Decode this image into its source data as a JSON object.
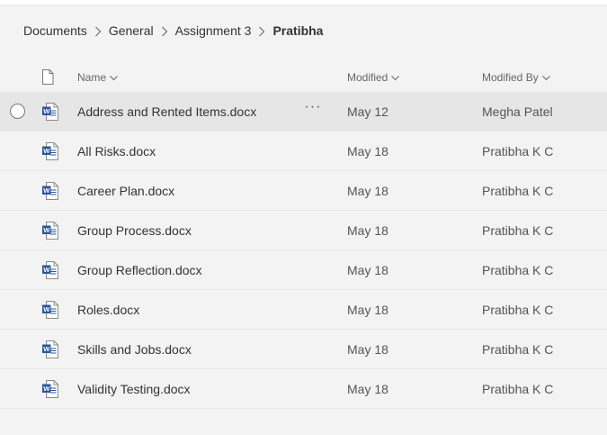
{
  "breadcrumb": {
    "items": [
      "Documents",
      "General",
      "Assignment 3"
    ],
    "current": "Pratibha"
  },
  "columns": {
    "name": "Name",
    "modified": "Modified",
    "modified_by": "Modified By"
  },
  "files": [
    {
      "name": "Address and Rented Items.docx",
      "modified": "May 12",
      "modified_by": "Megha Patel",
      "selected": true
    },
    {
      "name": "All Risks.docx",
      "modified": "May 18",
      "modified_by": "Pratibha K C"
    },
    {
      "name": "Career Plan.docx",
      "modified": "May 18",
      "modified_by": "Pratibha K C"
    },
    {
      "name": "Group Process.docx",
      "modified": "May 18",
      "modified_by": "Pratibha K C"
    },
    {
      "name": "Group Reflection.docx",
      "modified": "May 18",
      "modified_by": "Pratibha K C"
    },
    {
      "name": "Roles.docx",
      "modified": "May 18",
      "modified_by": "Pratibha K C"
    },
    {
      "name": "Skills and Jobs.docx",
      "modified": "May 18",
      "modified_by": "Pratibha K C"
    },
    {
      "name": "Validity Testing.docx",
      "modified": "May 18",
      "modified_by": "Pratibha K C"
    }
  ],
  "more_actions_glyph": "···",
  "colors": {
    "word_blue": "#2b579a",
    "selected_row": "#e6e6e6",
    "background": "#f3f3f3"
  },
  "icons": {
    "file_type_header": "document-icon",
    "file": "word-document-icon",
    "separator": "chevron-right-icon",
    "sort": "chevron-down-icon"
  }
}
